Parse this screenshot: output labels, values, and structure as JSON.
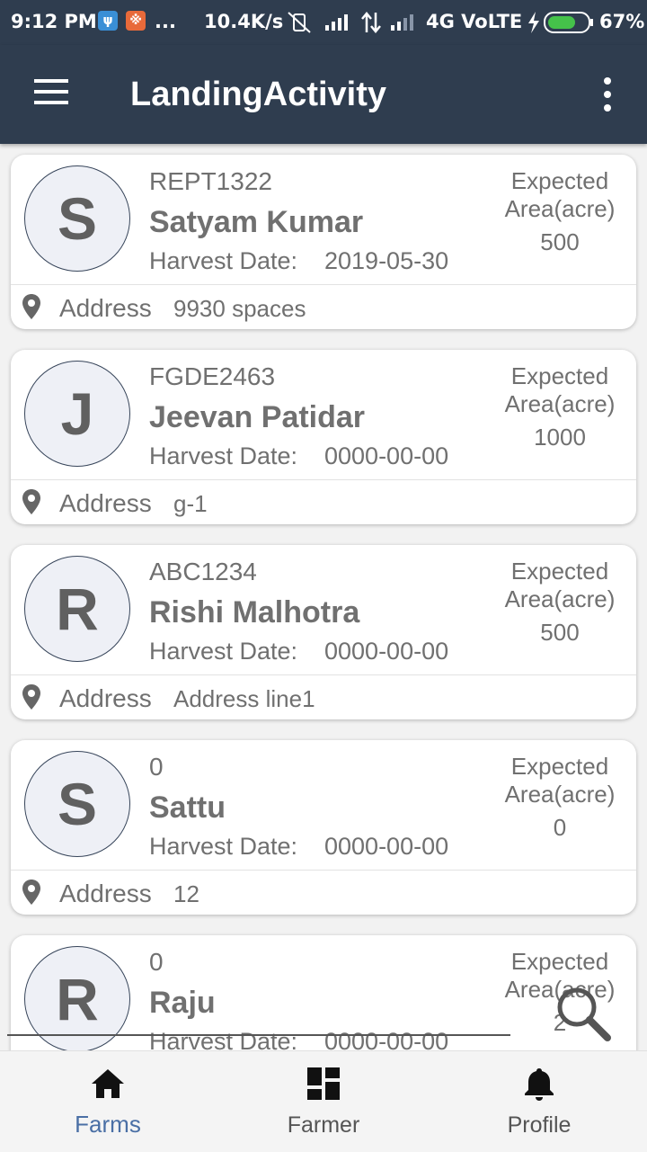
{
  "status_bar": {
    "time": "9:12 PM",
    "more": "...",
    "speed": "10.4K/s",
    "network": "4G VoLTE",
    "battery": "67%"
  },
  "app_bar": {
    "title": "LandingActivity"
  },
  "labels": {
    "harvest_date": "Harvest Date:",
    "expected_area": "Expected Area(acre)",
    "address": "Address"
  },
  "farms": [
    {
      "initial": "S",
      "code": "REPT1322",
      "name": "Satyam Kumar",
      "harvest_date": "2019-05-30",
      "area": "500",
      "address": "9930 spaces"
    },
    {
      "initial": "J",
      "code": "FGDE2463",
      "name": "Jeevan Patidar",
      "harvest_date": "0000-00-00",
      "area": "1000",
      "address": "g-1"
    },
    {
      "initial": "R",
      "code": "ABC1234",
      "name": "Rishi Malhotra",
      "harvest_date": "0000-00-00",
      "area": "500",
      "address": "Address line1"
    },
    {
      "initial": "S",
      "code": "0",
      "name": "Sattu",
      "harvest_date": "0000-00-00",
      "area": "0",
      "address": "12"
    },
    {
      "initial": "R",
      "code": "0",
      "name": "Raju",
      "harvest_date": "0000-00-00",
      "area": "2",
      "address": ""
    }
  ],
  "bottom_nav": [
    {
      "label": "Farms",
      "icon": "home-icon",
      "active": true
    },
    {
      "label": "Farmer",
      "icon": "dashboard-icon",
      "active": false
    },
    {
      "label": "Profile",
      "icon": "bell-icon",
      "active": false
    }
  ],
  "colors": {
    "app_bar": "#2f3d4f",
    "active_nav": "#4a6fa5",
    "inactive_nav": "#555555",
    "text_gray": "#707070"
  }
}
